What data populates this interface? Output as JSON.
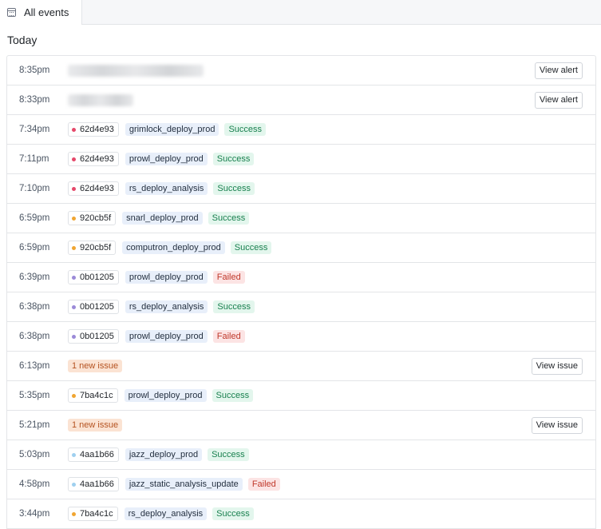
{
  "tab": {
    "label": "All events"
  },
  "section": {
    "title": "Today"
  },
  "rows": [
    {
      "time": "8:35pm",
      "kind": "alert",
      "blur_width": 170,
      "action": "View alert"
    },
    {
      "time": "8:33pm",
      "kind": "alert",
      "blur_width": 82,
      "action": "View alert"
    },
    {
      "time": "7:34pm",
      "kind": "deploy",
      "sha": "62d4e93",
      "dot_color": "#e5486a",
      "pipeline": "grimlock_deploy_prod",
      "status": "Success"
    },
    {
      "time": "7:11pm",
      "kind": "deploy",
      "sha": "62d4e93",
      "dot_color": "#e5486a",
      "pipeline": "prowl_deploy_prod",
      "status": "Success"
    },
    {
      "time": "7:10pm",
      "kind": "deploy",
      "sha": "62d4e93",
      "dot_color": "#e5486a",
      "pipeline": "rs_deploy_analysis",
      "status": "Success"
    },
    {
      "time": "6:59pm",
      "kind": "deploy",
      "sha": "920cb5f",
      "dot_color": "#f0a531",
      "pipeline": "snarl_deploy_prod",
      "status": "Success"
    },
    {
      "time": "6:59pm",
      "kind": "deploy",
      "sha": "920cb5f",
      "dot_color": "#f0a531",
      "pipeline": "computron_deploy_prod",
      "status": "Success"
    },
    {
      "time": "6:39pm",
      "kind": "deploy",
      "sha": "0b01205",
      "dot_color": "#9b8ad8",
      "pipeline": "prowl_deploy_prod",
      "status": "Failed"
    },
    {
      "time": "6:38pm",
      "kind": "deploy",
      "sha": "0b01205",
      "dot_color": "#9b8ad8",
      "pipeline": "rs_deploy_analysis",
      "status": "Success"
    },
    {
      "time": "6:38pm",
      "kind": "deploy",
      "sha": "0b01205",
      "dot_color": "#9b8ad8",
      "pipeline": "prowl_deploy_prod",
      "status": "Failed"
    },
    {
      "time": "6:13pm",
      "kind": "issue",
      "issue": "1 new issue",
      "action": "View issue"
    },
    {
      "time": "5:35pm",
      "kind": "deploy",
      "sha": "7ba4c1c",
      "dot_color": "#f0a531",
      "pipeline": "prowl_deploy_prod",
      "status": "Success"
    },
    {
      "time": "5:21pm",
      "kind": "issue",
      "issue": "1 new issue",
      "action": "View issue"
    },
    {
      "time": "5:03pm",
      "kind": "deploy",
      "sha": "4aa1b66",
      "dot_color": "#9fd0ef",
      "pipeline": "jazz_deploy_prod",
      "status": "Success"
    },
    {
      "time": "4:58pm",
      "kind": "deploy",
      "sha": "4aa1b66",
      "dot_color": "#9fd0ef",
      "pipeline": "jazz_static_analysis_update",
      "status": "Failed"
    },
    {
      "time": "3:44pm",
      "kind": "deploy",
      "sha": "7ba4c1c",
      "dot_color": "#f0a531",
      "pipeline": "rs_deploy_analysis",
      "status": "Success"
    }
  ]
}
